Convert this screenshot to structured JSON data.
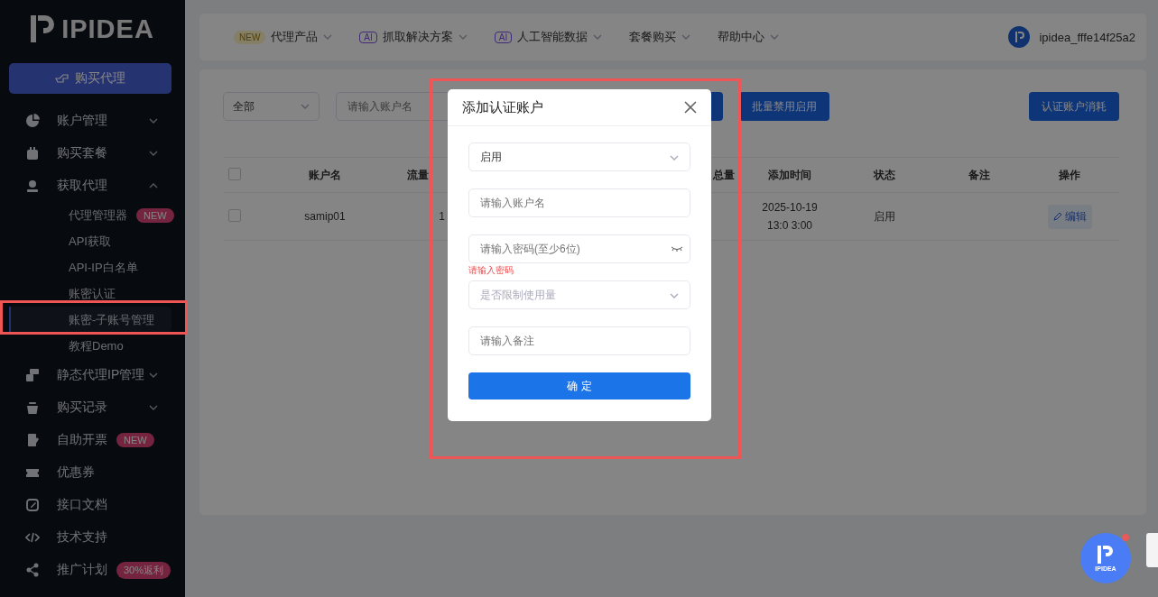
{
  "sidebar": {
    "logo": "IPIDEA",
    "buy_button": "购买代理",
    "items": [
      {
        "label": "账户管理",
        "kind": "group",
        "expanded": false
      },
      {
        "label": "购买套餐",
        "kind": "group",
        "expanded": false
      },
      {
        "label": "获取代理",
        "kind": "group",
        "expanded": true,
        "children": [
          {
            "label": "代理管理器",
            "badge": "NEW",
            "selected": false
          },
          {
            "label": "API获取",
            "selected": false
          },
          {
            "label": "API-IP白名单",
            "selected": false
          },
          {
            "label": "账密认证",
            "selected": false
          },
          {
            "label": "账密-子账号管理",
            "selected": true
          },
          {
            "label": "教程Demo",
            "selected": false
          }
        ]
      },
      {
        "label": "静态代理IP管理",
        "kind": "group",
        "expanded": false
      },
      {
        "label": "购买记录",
        "kind": "group",
        "expanded": false
      },
      {
        "label": "自助开票",
        "kind": "link",
        "badge": "NEW"
      },
      {
        "label": "优惠券",
        "kind": "link"
      },
      {
        "label": "接口文档",
        "kind": "link"
      },
      {
        "label": "技术支持",
        "kind": "link"
      },
      {
        "label": "推广计划",
        "kind": "link",
        "badge": "30%返利"
      }
    ]
  },
  "top_nav": {
    "items": [
      {
        "tag": "NEW",
        "kind": "new",
        "label": "代理产品"
      },
      {
        "tag": "AI",
        "kind": "ai",
        "label": "抓取解决方案"
      },
      {
        "tag": "AI",
        "kind": "ai",
        "label": "人工智能数据"
      },
      {
        "label": "套餐购买",
        "kind": "plain"
      },
      {
        "label": "帮助中心",
        "kind": "plain"
      }
    ],
    "user": "ipidea_fffe14f25a2"
  },
  "filters": {
    "status_select": "全部",
    "account_search": {
      "placeholder": "请输入账户名"
    },
    "buttons": [
      "批量禁用启用"
    ],
    "consume_button": "认证账户消耗"
  },
  "table": {
    "select_all_checked": false,
    "columns": [
      "账户名",
      "流量",
      "总量",
      "添加时间",
      "状态",
      "备注",
      "操作"
    ],
    "rows": [
      {
        "checked": false,
        "cells": [
          "samip01",
          "1",
          "",
          "2025-10-19 13:0 3:00",
          "启用",
          ""
        ],
        "action": "编辑"
      }
    ]
  },
  "dialog": {
    "title": "添加认证账户",
    "fields": [
      {
        "kind": "select",
        "value": "启用"
      },
      {
        "kind": "input",
        "placeholder": "请输入账户名"
      },
      {
        "kind": "password",
        "placeholder": "请输入密码(至少6位)",
        "error": "请输入密码"
      },
      {
        "kind": "select",
        "placeholder": "是否限制使用量"
      },
      {
        "kind": "input",
        "placeholder": "请输入备注"
      }
    ],
    "submit": "确 定"
  },
  "float_button": {
    "label": "IPIDEA",
    "unread": true
  }
}
